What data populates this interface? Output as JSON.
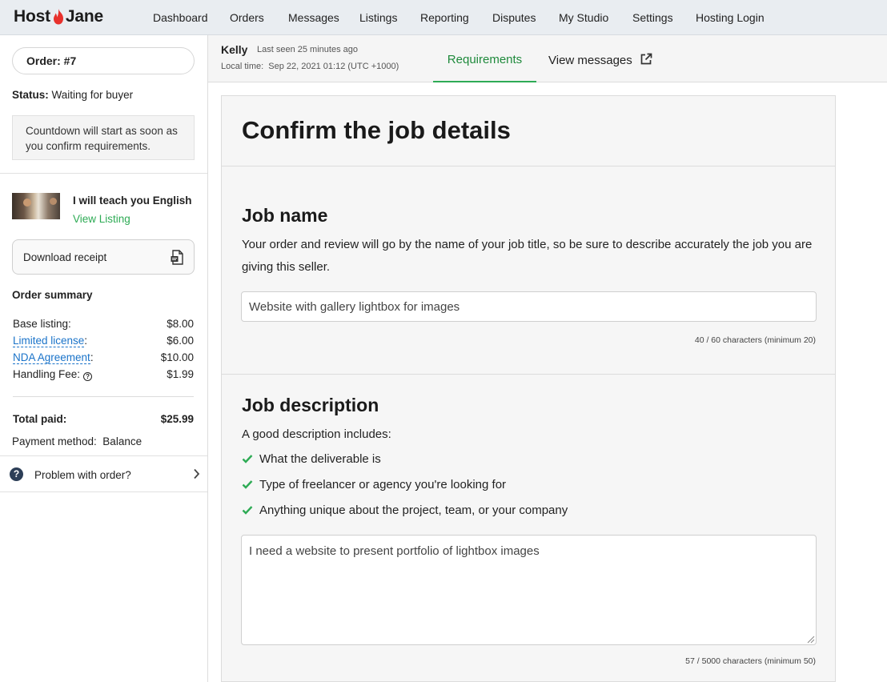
{
  "nav": {
    "logo_left": "Host",
    "logo_right": "Jane",
    "links": [
      "Dashboard",
      "Orders",
      "Messages",
      "Listings",
      "Reporting",
      "Disputes",
      "My Studio",
      "Settings",
      "Hosting Login"
    ]
  },
  "sidebar": {
    "order_label": "Order: #7",
    "status_label": "Status:",
    "status_value": "Waiting for buyer",
    "countdown_note": "Countdown will start as soon as you confirm requirements.",
    "listing_title": "I will teach you English",
    "view_listing": "View Listing",
    "download_receipt": "Download receipt",
    "summary_title": "Order summary",
    "summary_rows": [
      {
        "label": "Base listing:",
        "value": "$8.00"
      },
      {
        "label": "Limited license",
        "suffix": ":",
        "value": "$6.00"
      },
      {
        "label": "NDA Agreement",
        "suffix": ":",
        "value": "$10.00"
      },
      {
        "label": "Handling Fee:",
        "value": "$1.99"
      }
    ],
    "total_label": "Total paid:",
    "total_value": "$25.99",
    "payment_method": "Payment method:  Balance",
    "problem": "Problem with order?"
  },
  "header": {
    "buyer_name": "Kelly",
    "last_seen": "Last seen 25 minutes ago",
    "local_time": "Local time:  Sep 22, 2021 01:12 (UTC +1000)",
    "tabs": [
      "Requirements",
      "View messages"
    ]
  },
  "main": {
    "title": "Confirm the job details",
    "job_name": {
      "heading": "Job name",
      "help": "Your order and review will go by the name of your job title, so be sure to describe accurately the job you are giving this seller.",
      "value": "Website with gallery lightbox for images",
      "counter": "40 / 60 characters (minimum 20)"
    },
    "job_description": {
      "heading": "Job description",
      "intro": "A good description includes:",
      "checklist": [
        "What the deliverable is",
        "Type of freelancer or agency you're looking for",
        "Anything unique about the project, team, or your company"
      ],
      "value": "I need a website to present portfolio of lightbox images",
      "counter": "57 / 5000 characters (minimum 50)"
    }
  },
  "colors": {
    "accent_green": "#2eab55",
    "logo_red": "#e8312c",
    "link_blue": "#1a73c9"
  }
}
